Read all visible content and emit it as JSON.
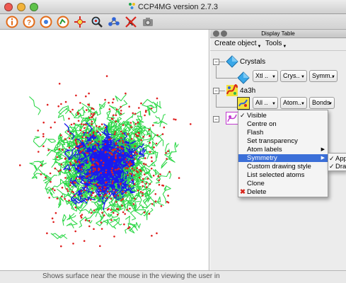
{
  "window": {
    "title": "CCP4MG version 2.7.3"
  },
  "toolbar": {
    "icons": [
      "info-icon",
      "help-icon",
      "recentre-icon",
      "bones-icon",
      "target-icon",
      "zoom-search-icon",
      "network-icon",
      "bond-breaker-icon",
      "camera-icon"
    ]
  },
  "panel": {
    "title": "Display Table",
    "menu": {
      "create_object": "Create object",
      "tools": "Tools"
    },
    "objects": [
      {
        "name": "Crystals",
        "icon": "crystal-icon",
        "buttons": [
          "Xtl ..",
          "Crys..",
          "Symm.."
        ]
      },
      {
        "name": "4a3h",
        "icon": "protein-icon",
        "buttons": [
          "All ..",
          "Atom..",
          "Bonds"
        ]
      },
      {
        "name": "",
        "icon": "model-icon",
        "buttons": []
      }
    ]
  },
  "context_menu": {
    "items": [
      {
        "label": "Visible",
        "checked": true,
        "submenu": false
      },
      {
        "label": "Centre on",
        "checked": false,
        "submenu": false
      },
      {
        "label": "Flash",
        "checked": false,
        "submenu": false
      },
      {
        "label": "Set transparency",
        "checked": false,
        "submenu": false
      },
      {
        "label": "Atom labels",
        "checked": false,
        "submenu": true
      },
      {
        "label": "Symmetry",
        "checked": false,
        "submenu": true,
        "highlighted": true
      },
      {
        "label": "Custom drawing style",
        "checked": false,
        "submenu": false
      },
      {
        "label": "List selected atoms",
        "checked": false,
        "submenu": false
      },
      {
        "label": "Clone",
        "checked": false,
        "submenu": false
      },
      {
        "label": "Delete",
        "checked": false,
        "submenu": false,
        "icon": "delete-icon"
      }
    ]
  },
  "submenu": {
    "items": [
      "App",
      "Dra"
    ]
  },
  "status": {
    "text": "Shows surface near the mouse in the viewing the user in"
  },
  "colors": {
    "highlight": "#3b6fd8",
    "bonds_green": "#2fd84a",
    "atoms_blue": "#1a1aee",
    "water_red": "#e02020"
  }
}
